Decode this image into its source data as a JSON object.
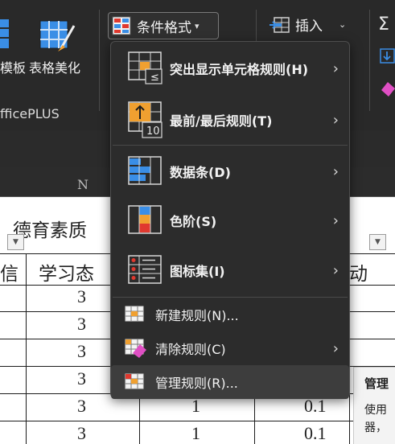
{
  "ribbon": {
    "template_label_partial": "模板",
    "beautify_label": "表格美化",
    "group_label_partial": "fficePLUS",
    "conditional_format_label": "条件格式",
    "insert_label": "插入"
  },
  "sheet": {
    "column_header": "N",
    "section_title": "德育素质",
    "col_partial_left": "信",
    "col_attitude_partial": "学习态",
    "col_activity_partial": "动",
    "col_n_values": [
      "3",
      "3",
      "3",
      "3",
      "3",
      "3"
    ],
    "col_p_values": [
      "1",
      "1"
    ],
    "col_q_values": [
      "0.1",
      "0.1"
    ]
  },
  "menu": {
    "items": [
      {
        "label": "突出显示单元格规则(H)",
        "icon": "highlight-cells-rules-icon",
        "submenu": true
      },
      {
        "label": "最前/最后规则(T)",
        "icon": "top-bottom-rules-icon",
        "submenu": true
      },
      {
        "label": "数据条(D)",
        "icon": "data-bars-icon",
        "submenu": true
      },
      {
        "label": "色阶(S)",
        "icon": "color-scales-icon",
        "submenu": true
      },
      {
        "label": "图标集(I)",
        "icon": "icon-sets-icon",
        "submenu": true
      },
      {
        "label": "新建规则(N)...",
        "icon": "new-rule-icon",
        "submenu": false
      },
      {
        "label": "清除规则(C)",
        "icon": "clear-rules-icon",
        "submenu": true
      },
      {
        "label": "管理规则(R)...",
        "icon": "manage-rules-icon",
        "submenu": false
      }
    ],
    "badge_le": "≤",
    "badge_ten": "10"
  },
  "tooltip": {
    "title_partial": "管理",
    "body_line1": "使用",
    "body_line2": "器，"
  },
  "colors": {
    "ribbon_bg": "#292929",
    "menu_bg": "#2c2c2c",
    "accent_orange": "#f0a030",
    "accent_blue": "#3a8ee6",
    "red": "#e0392f"
  }
}
